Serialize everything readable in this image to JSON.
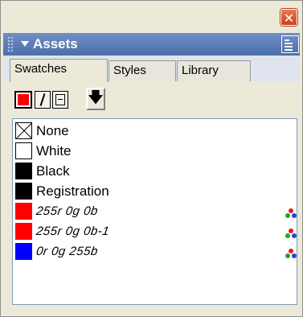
{
  "window": {
    "close_glyph": "✕"
  },
  "panel": {
    "title": "Assets",
    "collapse_icon": "triangle-down",
    "options_icon": "panel-menu"
  },
  "tabs": [
    {
      "label": "Swatches",
      "active": true
    },
    {
      "label": "Styles",
      "active": false
    },
    {
      "label": "Library",
      "active": false
    }
  ],
  "toolbar": {
    "fill_color": "#ff0000",
    "stroke_icon": "slash",
    "tint_icon": "tint-box",
    "apply_arrow": "🡇"
  },
  "swatches": [
    {
      "name": "None",
      "chip": "none",
      "color": "none",
      "italic": false,
      "rgb_mode": false
    },
    {
      "name": "White",
      "chip": "white",
      "color": "#ffffff",
      "italic": false,
      "rgb_mode": false
    },
    {
      "name": "Black",
      "chip": "solid",
      "color": "#000000",
      "italic": false,
      "rgb_mode": false
    },
    {
      "name": "Registration",
      "chip": "solid",
      "color": "#000000",
      "italic": false,
      "rgb_mode": false
    },
    {
      "name": "255r 0g 0b",
      "chip": "solid",
      "color": "#ff0000",
      "italic": true,
      "rgb_mode": true
    },
    {
      "name": "255r 0g 0b-1",
      "chip": "solid",
      "color": "#ff0000",
      "italic": true,
      "rgb_mode": true
    },
    {
      "name": "0r 0g 255b",
      "chip": "solid",
      "color": "#0000ff",
      "italic": true,
      "rgb_mode": true
    }
  ],
  "colors": {
    "header": "#5a7bb5",
    "panel_bg": "#ece9d8",
    "list_border": "#7f9db9"
  }
}
